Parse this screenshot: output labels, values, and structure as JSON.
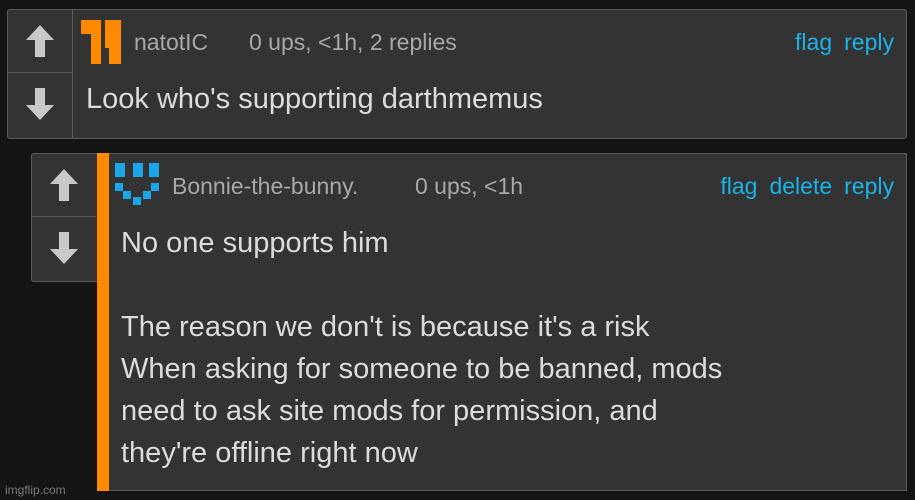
{
  "comments": [
    {
      "username": "natotIC",
      "meta": "0 ups, <1h, 2 replies",
      "text": "Look who's supporting darthmemus",
      "actions": [
        "flag",
        "reply"
      ]
    },
    {
      "username": "Bonnie-the-bunny.",
      "meta": "0 ups, <1h",
      "text": "No one supports him\n\nThe reason we don't is because it's a risk\nWhen asking for someone to be banned, mods\nneed to ask site mods for permission, and\nthey're offline right now",
      "actions": [
        "flag",
        "delete",
        "reply"
      ]
    }
  ],
  "watermark": "imgflip.com",
  "colors": {
    "accent": "#1ab2e8",
    "reply_bar": "#ff8a00",
    "avatar_orange": "#ff8a00",
    "avatar_blue": "#1aa6e8"
  },
  "icons": {
    "upvote": "up-arrow-icon",
    "downvote": "down-arrow-icon"
  }
}
